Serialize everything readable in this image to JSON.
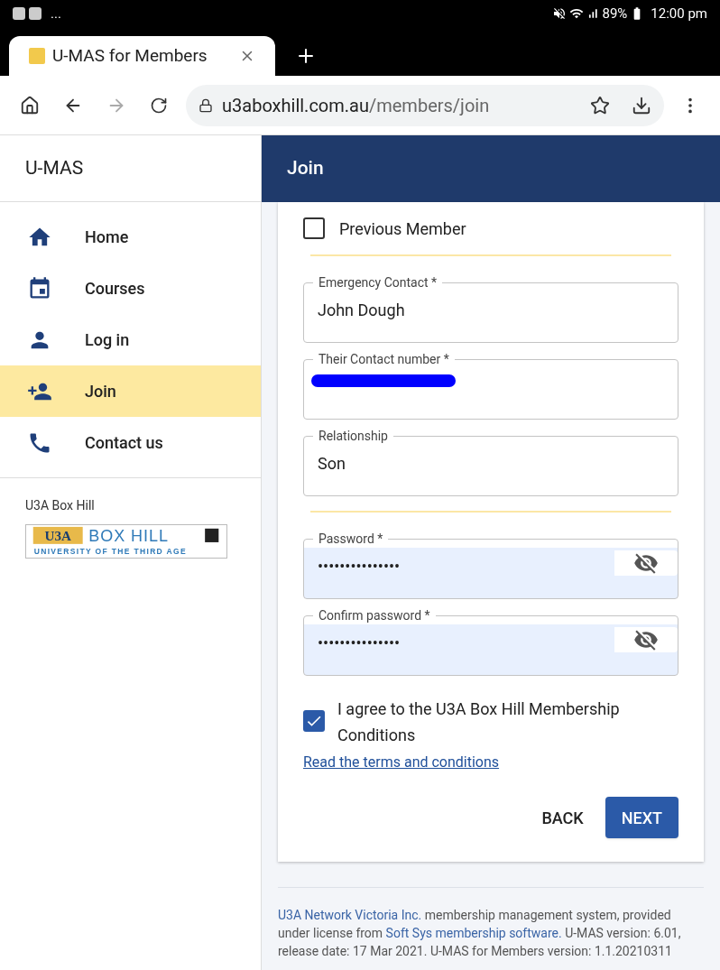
{
  "status_bar": {
    "notifications": "...",
    "battery": "89%",
    "time": "12:00 pm"
  },
  "browser": {
    "tab_title": "U-MAS for Members",
    "url_host": "u3aboxhill.com.au",
    "url_path": "/members/join"
  },
  "app": {
    "title": "U-MAS",
    "page_title": "Join"
  },
  "nav": [
    {
      "label": "Home",
      "selected": false
    },
    {
      "label": "Courses",
      "selected": false
    },
    {
      "label": "Log in",
      "selected": false
    },
    {
      "label": "Join",
      "selected": true
    },
    {
      "label": "Contact us",
      "selected": false
    }
  ],
  "sidebar_footer": {
    "caption": "U3A Box Hill",
    "logo_mark": "U3A",
    "logo_name": "BOX HILL",
    "logo_tagline": "UNIVERSITY OF THE THIRD AGE"
  },
  "form": {
    "previous_member": {
      "label": "Previous Member",
      "checked": false
    },
    "sections": [
      {
        "fields": [
          {
            "kind": "text",
            "label": "Emergency Contact *",
            "value": "John Dough"
          },
          {
            "kind": "redacted",
            "label": "Their Contact number *"
          },
          {
            "kind": "text",
            "label": "Relationship",
            "value": "Son"
          }
        ]
      },
      {
        "fields": [
          {
            "kind": "password",
            "label": "Password *",
            "value": "•••••••••••••••"
          },
          {
            "kind": "password",
            "label": "Confirm password *",
            "value": "•••••••••••••••"
          }
        ]
      }
    ],
    "agree": {
      "label": "I agree to the U3A Box Hill Membership Conditions",
      "checked": true
    },
    "terms_link": "Read the terms and conditions",
    "buttons": [
      {
        "kind": "text",
        "label": "BACK"
      },
      {
        "kind": "primary",
        "label": "NEXT"
      }
    ]
  },
  "footer": [
    {
      "kind": "link",
      "text": "U3A Network Victoria Inc."
    },
    {
      "kind": "text",
      "text": " membership management system, provided under license from "
    },
    {
      "kind": "link",
      "text": "Soft Sys membership software."
    },
    {
      "kind": "text",
      "text": " U-MAS version: 6.01, release date: 17 Mar 2021. U-MAS for Members version: 1.1.20210311"
    }
  ]
}
